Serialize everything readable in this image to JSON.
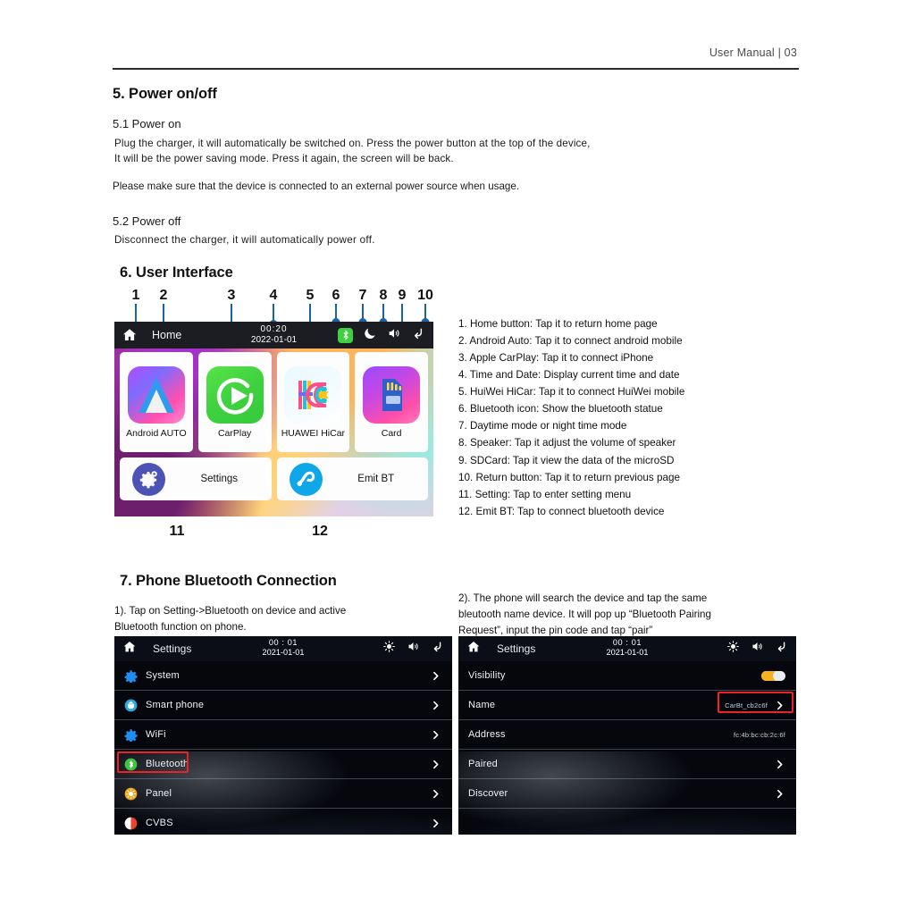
{
  "header": {
    "text": "User Manual  |  03"
  },
  "section5": {
    "title": "5. Power on/off",
    "sub1": "5.1  Power on",
    "para1_line1": "Plug  the  charger,   it   will   automatically   be  switched on.   Press  the power button at the top of the device,",
    "para1_line2": "It will be the power saving mode. Press  it  again,   the  screen  will  be  back.",
    "para2": "Please make sure that the device is connected to an external power source when usage.",
    "sub2": "5.2  Power off",
    "para3": "Disconnect  the  charger, it  will  automatically  power  off."
  },
  "section6": {
    "title": "6. User Interface",
    "callouts": [
      "1",
      "2",
      "3",
      "4",
      "5",
      "6",
      "7",
      "8",
      "9",
      "10",
      "11",
      "12"
    ],
    "device": {
      "topbar": {
        "title": "Home",
        "time": "00:20",
        "date": "2022-01-01",
        "icons": [
          "home-icon",
          "bluetooth-icon",
          "night-mode-icon",
          "speaker-icon",
          "return-icon"
        ]
      },
      "apps": [
        {
          "label": "Android AUTO",
          "icon": "android-auto-icon"
        },
        {
          "label": "CarPlay",
          "icon": "carplay-icon"
        },
        {
          "label": "HUAWEI HiCar",
          "icon": "huawei-hicar-icon"
        },
        {
          "label": "Card",
          "icon": "sd-card-icon"
        }
      ],
      "wide": [
        {
          "label": "Settings",
          "icon": "gears-icon"
        },
        {
          "label": "Emit BT",
          "icon": "emit-bt-icon"
        }
      ]
    },
    "legend": [
      "1. Home button: Tap it to return home page",
      "2. Android Auto: Tap it to connect android mobile",
      "3. Apple CarPlay: Tap it to connect iPhone",
      "4. Time and Date: Display current time and date",
      "5. HuiWei HiCar: Tap it to connect HuiWei mobile",
      "6. Bluetooth icon: Show the bluetooth statue",
      "7. Daytime mode or night time mode",
      "8. Speaker: Tap it adjust the volume of speaker",
      "9. SDCard: Tap it view  the data of the microSD",
      "10. Return button: Tap it to return previous page",
      "11. Setting: Tap to enter setting menu",
      "12. Emit BT: Tap to connect bluetooth device"
    ]
  },
  "section7": {
    "title": "7. Phone Bluetooth Connection",
    "step1_line1": "1). Tap on Setting->Bluetooth on device and active",
    "step1_line2": "Bluetooth function on phone.",
    "step2_line1": "2). The phone will search the device and tap the same",
    "step2_line2": "bleutooth name device. It will pop up “Bluetooth Pairing",
    "step2_line3": "Request”, input the pin code and tap “pair”",
    "settings_left": {
      "topbar": {
        "title": "Settings",
        "time": "00 : 01",
        "date": "2021-01-01"
      },
      "rows": [
        {
          "label": "System",
          "icon": "gear-icon"
        },
        {
          "label": "Smart phone",
          "icon": "android-icon"
        },
        {
          "label": "WiFi",
          "icon": "gear-icon"
        },
        {
          "label": "Bluetooth",
          "icon": "bluetooth-icon",
          "highlighted": true
        },
        {
          "label": "Panel",
          "icon": "brightness-icon"
        },
        {
          "label": "CVBS",
          "icon": "contrast-icon"
        }
      ]
    },
    "settings_right": {
      "topbar": {
        "title": "Settings",
        "time": "00 : 01",
        "date": "2021-01-01"
      },
      "rows": [
        {
          "label": "Visibility",
          "control": "toggle",
          "toggle_on": true
        },
        {
          "label": "Name",
          "value": "CarBt_cb2c6f",
          "control": "chevron",
          "highlighted": true
        },
        {
          "label": "Address",
          "value": "fc:4b:bc:cb:2c:6f",
          "control": "none"
        },
        {
          "label": "Paired",
          "control": "chevron"
        },
        {
          "label": "Discover",
          "control": "chevron"
        }
      ]
    }
  },
  "colors": {
    "accent_blue": "#1763a6",
    "highlight_red": "#ee2222",
    "toggle_on": "#f5b21c",
    "topbar_dark": "#1b1d22"
  }
}
